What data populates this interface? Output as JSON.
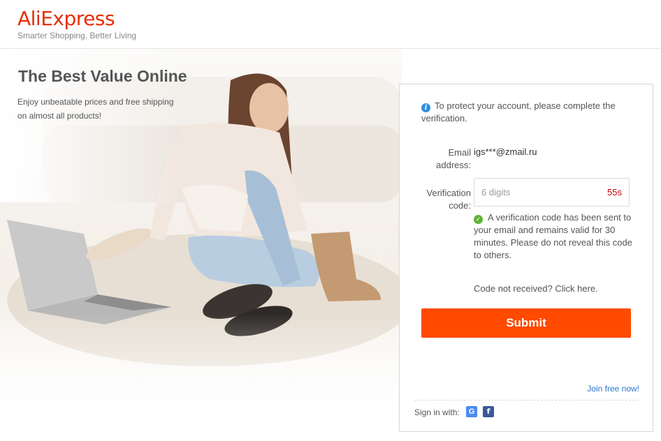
{
  "header": {
    "logo_ali": "Ali",
    "logo_express": "Express",
    "tagline": "Smarter Shopping, Better Living"
  },
  "hero": {
    "title": "The Best Value Online",
    "subtitle": "Enjoy unbeatable prices and free shipping on almost all products!"
  },
  "verification": {
    "notice": "To protect your account, please complete the verification.",
    "email_label": "Email address:",
    "email_value": "igs***@zmail.ru",
    "code_label": "Verification code:",
    "code_placeholder": "6 digits",
    "code_value": "",
    "countdown": "55s",
    "sent_message": "A verification code has been sent to your email and remains valid for 30 minutes. Please do not reveal this code to others.",
    "resend_link": "Code not received? Click here.",
    "submit_label": "Submit",
    "join_link": "Join free now!",
    "signin_with": "Sign in with:",
    "google_label": "G",
    "facebook_label": "f"
  },
  "icons": {
    "info": "info-icon",
    "check": "check-circle-icon",
    "google": "google-icon",
    "facebook": "facebook-icon"
  },
  "colors": {
    "brand": "#e62e04",
    "submit": "#ff4a00",
    "countdown": "#cc0000",
    "link": "#2a77c9",
    "info": "#2d8ee0",
    "success": "#5fb336"
  }
}
